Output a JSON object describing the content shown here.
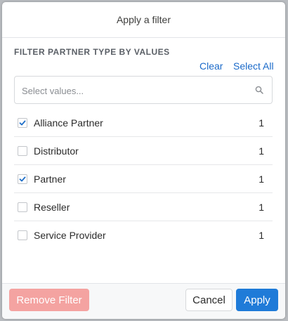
{
  "modal": {
    "title": "Apply a filter",
    "section_title": "FILTER PARTNER TYPE BY VALUES",
    "clear_label": "Clear",
    "select_all_label": "Select All",
    "search": {
      "placeholder": "Select values...",
      "value": ""
    },
    "options": [
      {
        "label": "Alliance Partner",
        "count": "1",
        "checked": true
      },
      {
        "label": "Distributor",
        "count": "1",
        "checked": false
      },
      {
        "label": "Partner",
        "count": "1",
        "checked": true
      },
      {
        "label": "Reseller",
        "count": "1",
        "checked": false
      },
      {
        "label": "Service Provider",
        "count": "1",
        "checked": false
      }
    ],
    "buttons": {
      "remove_filter": "Remove Filter",
      "cancel": "Cancel",
      "apply": "Apply"
    }
  },
  "colors": {
    "accent": "#1f7bd8",
    "link": "#1b6ac9",
    "remove_disabled": "#f4a3a1"
  }
}
